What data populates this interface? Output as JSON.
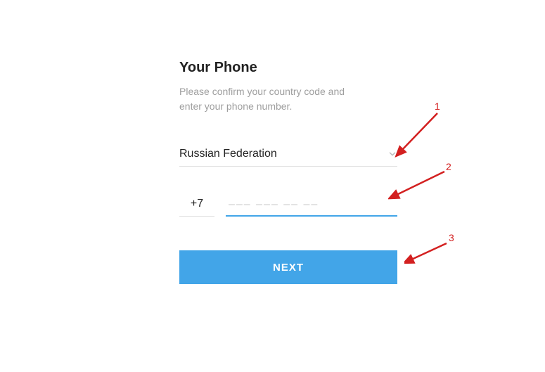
{
  "form": {
    "title": "Your Phone",
    "subtitle": "Please confirm your country code and enter your phone number.",
    "country": "Russian Federation",
    "prefix": "+7",
    "phone_value": "",
    "phone_placeholder": "––– ––– –– ––",
    "next_label": "NEXT"
  },
  "annotations": {
    "a1": "1",
    "a2": "2",
    "a3": "3"
  },
  "colors": {
    "accent": "#42a5e8",
    "annotation": "#d32020"
  }
}
